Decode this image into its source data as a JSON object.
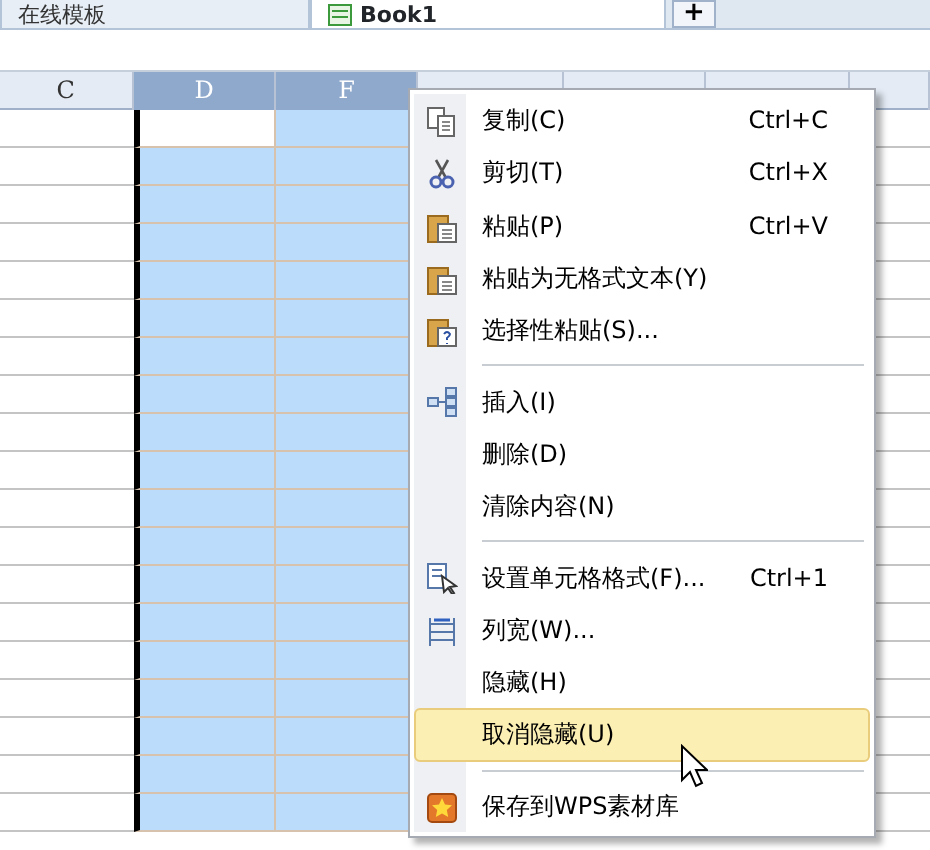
{
  "tabs": [
    {
      "label": "在线模板",
      "selected": false
    },
    {
      "label": "Book1",
      "selected": true
    }
  ],
  "new_tab_button": "+",
  "column_headers": [
    {
      "label": "C",
      "selected": false
    },
    {
      "label": "D",
      "selected": true
    },
    {
      "label": "F",
      "selected": true
    }
  ],
  "context_menu": [
    {
      "kind": "item",
      "label": "复制(C)",
      "shortcut": "Ctrl+C",
      "selected": false
    },
    {
      "kind": "item",
      "label": "剪切(T)",
      "shortcut": "Ctrl+X",
      "selected": false
    },
    {
      "kind": "item",
      "label": "粘贴(P)",
      "shortcut": "Ctrl+V",
      "selected": false
    },
    {
      "kind": "item",
      "label": "粘贴为无格式文本(Y)",
      "selected": false
    },
    {
      "kind": "item",
      "label": "选择性粘贴(S)...",
      "selected": false
    },
    {
      "kind": "separator"
    },
    {
      "kind": "item",
      "label": "插入(I)",
      "selected": false
    },
    {
      "kind": "item",
      "label": "删除(D)",
      "selected": false
    },
    {
      "kind": "item",
      "label": "清除内容(N)",
      "selected": false
    },
    {
      "kind": "separator"
    },
    {
      "kind": "item",
      "label": "设置单元格格式(F)...",
      "shortcut": "Ctrl+1",
      "selected": false
    },
    {
      "kind": "item",
      "label": "列宽(W)...",
      "selected": false
    },
    {
      "kind": "item",
      "label": "隐藏(H)",
      "selected": false
    },
    {
      "kind": "item",
      "label": "取消隐藏(U)",
      "selected": true
    },
    {
      "kind": "separator"
    },
    {
      "kind": "item",
      "label": "保存到WPS素材库",
      "selected": false
    }
  ]
}
